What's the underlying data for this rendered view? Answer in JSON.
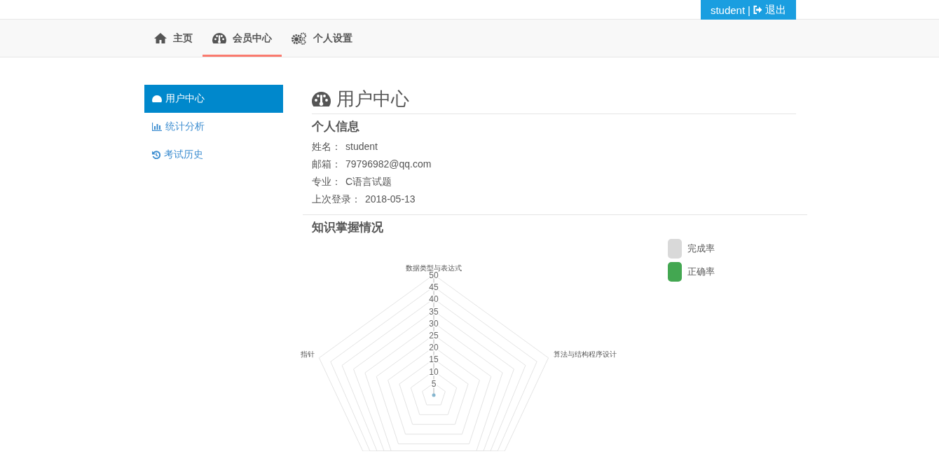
{
  "top_bar": {
    "username": "student",
    "separator": "|",
    "logout": "退出"
  },
  "nav": [
    {
      "label": "主页",
      "kind": "home",
      "selected": false
    },
    {
      "label": "会员中心",
      "kind": "dashboard",
      "selected": true
    },
    {
      "label": "个人设置",
      "kind": "gears",
      "selected": false
    }
  ],
  "sidebar": [
    {
      "label": "用户中心",
      "kind": "dashboard",
      "selected": true
    },
    {
      "label": "统计分析",
      "kind": "bar-chart",
      "selected": false
    },
    {
      "label": "考试历史",
      "kind": "history",
      "selected": false
    }
  ],
  "page_title": "用户中心",
  "profile": {
    "title": "个人信息",
    "fields": [
      {
        "label": "姓名：",
        "value": "student"
      },
      {
        "label": "邮箱：",
        "value": "79796982@qq.com"
      },
      {
        "label": "专业：",
        "value": "C语言试题"
      },
      {
        "label": "上次登录：",
        "value": "2018-05-13"
      }
    ]
  },
  "knowledge": {
    "title": "知识掌握情况",
    "legend": [
      {
        "label": "完成率",
        "color": "#d9d9d9"
      },
      {
        "label": "正确率",
        "color": "#43a751"
      }
    ],
    "axes": [
      "数据类型与表达式",
      "指针",
      "算法与结构程序设计"
    ],
    "ticks": [
      "50",
      "45",
      "40",
      "35",
      "30",
      "25",
      "20",
      "15",
      "10",
      "5"
    ]
  }
}
